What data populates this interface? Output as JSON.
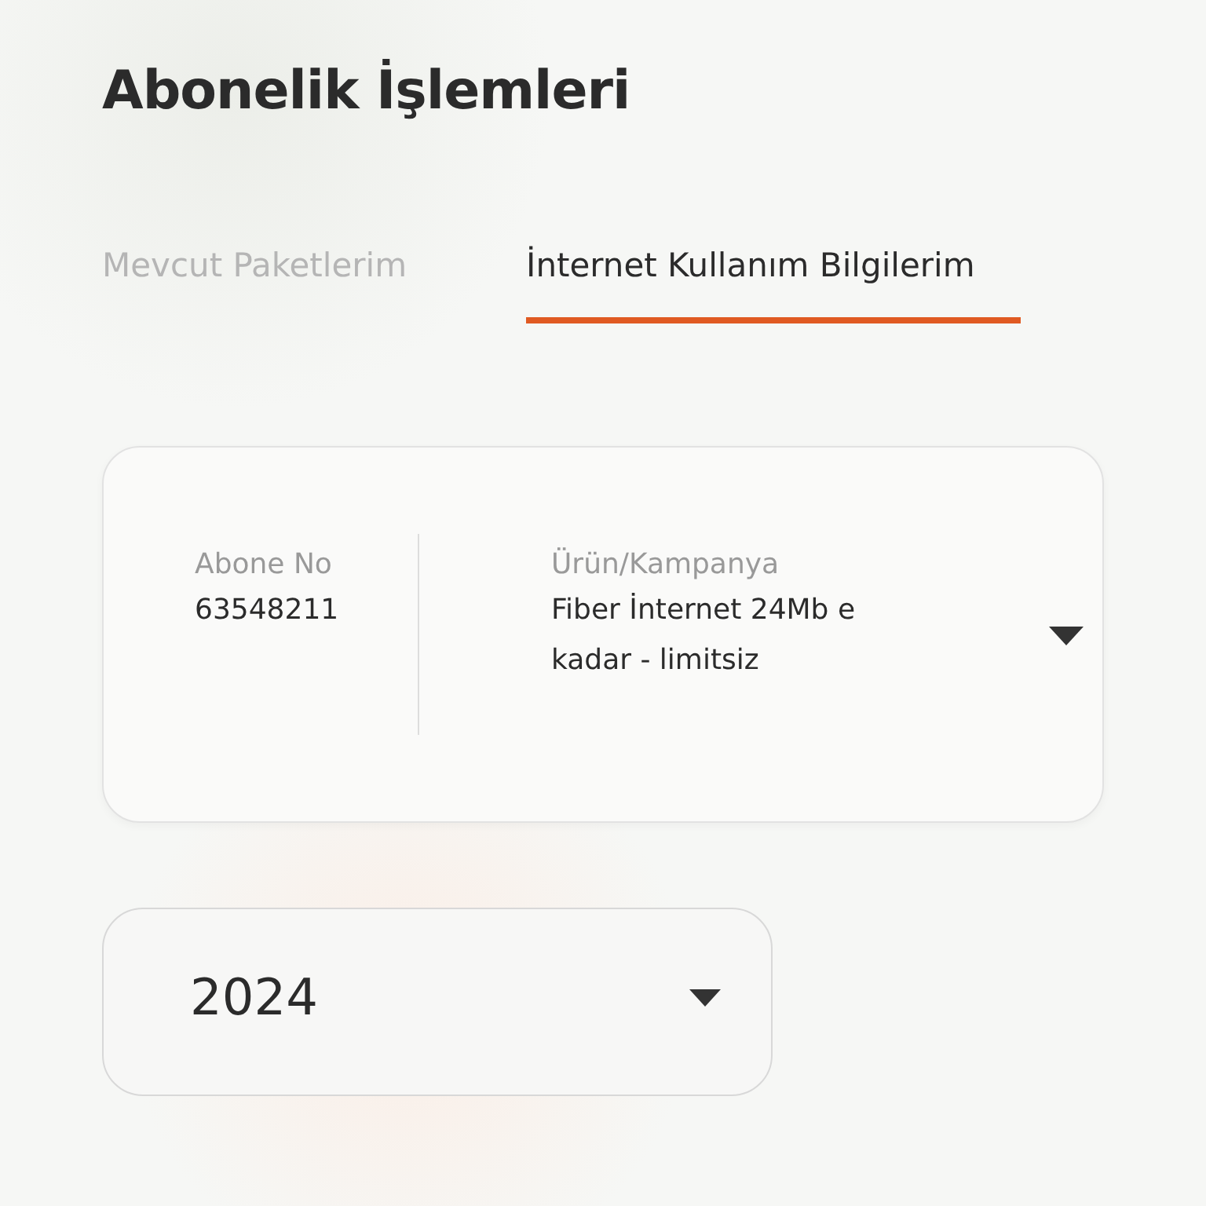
{
  "title": "Abonelik İşlemleri",
  "tabs": [
    {
      "label": "Mevcut Paketlerim",
      "selected": false
    },
    {
      "label": "İnternet Kullanım Bilgilerim",
      "selected": true
    }
  ],
  "subscription": {
    "subscriber_label": "Abone No",
    "subscriber_no": "63548211",
    "product_label": "Ürün/Kampanya",
    "product_value": "Fiber İnternet 24Mb e kadar - limitsiz"
  },
  "year_select": {
    "value": "2024"
  }
}
